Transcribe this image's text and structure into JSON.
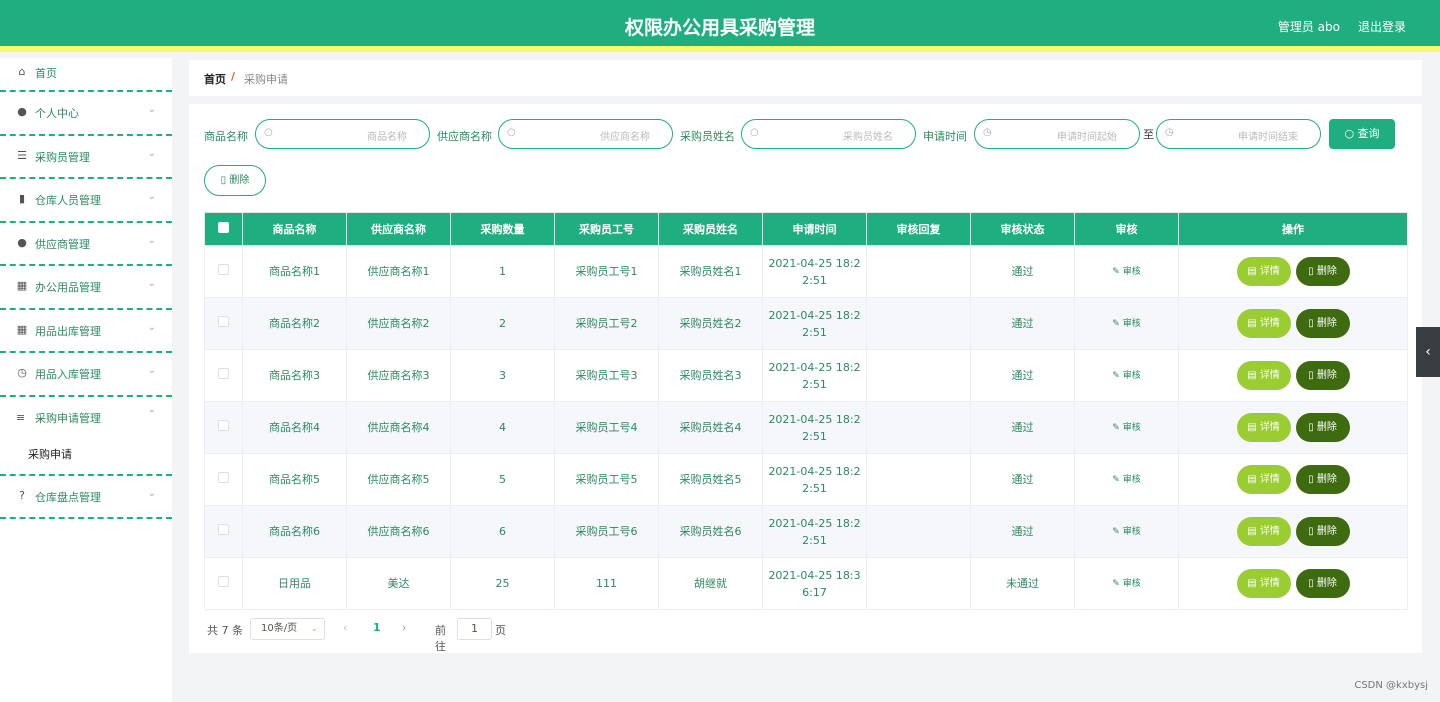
{
  "header": {
    "title": "权限办公用具采购管理",
    "user": "管理员 abo",
    "logout": "退出登录"
  },
  "sidebar": {
    "items": [
      {
        "label": "首页",
        "icon": "home-icon",
        "glyph": "⌂"
      },
      {
        "label": "个人中心",
        "icon": "user-icon",
        "glyph": "●"
      },
      {
        "label": "采购员管理",
        "icon": "list-icon",
        "glyph": "☰"
      },
      {
        "label": "仓库人员管理",
        "icon": "clipboard-icon",
        "glyph": "▮"
      },
      {
        "label": "供应商管理",
        "icon": "user-icon",
        "glyph": "●"
      },
      {
        "label": "办公用品管理",
        "icon": "grid-icon",
        "glyph": "▦"
      },
      {
        "label": "用品出库管理",
        "icon": "grid-icon",
        "glyph": "▦"
      },
      {
        "label": "用品入库管理",
        "icon": "compass-icon",
        "glyph": "◷"
      }
    ],
    "open_group": {
      "label": "采购申请管理",
      "icon": "menu-icon",
      "glyph": "≡",
      "sub": "采购申请"
    },
    "last": {
      "label": "仓库盘点管理",
      "icon": "help-icon",
      "glyph": "?"
    }
  },
  "breadcrumb": {
    "home": "首页",
    "sep": "/",
    "current": "采购申请"
  },
  "search": {
    "name_label": "商品名称",
    "name_ph": "商品名称",
    "supplier_label": "供应商名称",
    "supplier_ph": "供应商名称",
    "buyer_label": "采购员姓名",
    "buyer_ph": "采购员姓名",
    "time_label": "申请时间",
    "time_start_ph": "申请时间起始",
    "range_sep": "至",
    "time_end_ph": "申请时间结束",
    "query_btn": "查询",
    "delete_btn": "删除"
  },
  "table": {
    "headers": [
      "商品名称",
      "供应商名称",
      "采购数量",
      "采购员工号",
      "采购员姓名",
      "申请时间",
      "审核回复",
      "审核状态",
      "审核",
      "操作"
    ],
    "rows": [
      {
        "name": "商品名称1",
        "supplier": "供应商名称1",
        "qty": "1",
        "no": "采购员工号1",
        "buyer": "采购员姓名1",
        "time1": "2021-04-25 18:2",
        "time2": "2:51",
        "reply": "",
        "status": "通过",
        "review": "审核"
      },
      {
        "name": "商品名称2",
        "supplier": "供应商名称2",
        "qty": "2",
        "no": "采购员工号2",
        "buyer": "采购员姓名2",
        "time1": "2021-04-25 18:2",
        "time2": "2:51",
        "reply": "",
        "status": "通过",
        "review": "审核"
      },
      {
        "name": "商品名称3",
        "supplier": "供应商名称3",
        "qty": "3",
        "no": "采购员工号3",
        "buyer": "采购员姓名3",
        "time1": "2021-04-25 18:2",
        "time2": "2:51",
        "reply": "",
        "status": "通过",
        "review": "审核"
      },
      {
        "name": "商品名称4",
        "supplier": "供应商名称4",
        "qty": "4",
        "no": "采购员工号4",
        "buyer": "采购员姓名4",
        "time1": "2021-04-25 18:2",
        "time2": "2:51",
        "reply": "",
        "status": "通过",
        "review": "审核"
      },
      {
        "name": "商品名称5",
        "supplier": "供应商名称5",
        "qty": "5",
        "no": "采购员工号5",
        "buyer": "采购员姓名5",
        "time1": "2021-04-25 18:2",
        "time2": "2:51",
        "reply": "",
        "status": "通过",
        "review": "审核"
      },
      {
        "name": "商品名称6",
        "supplier": "供应商名称6",
        "qty": "6",
        "no": "采购员工号6",
        "buyer": "采购员姓名6",
        "time1": "2021-04-25 18:2",
        "time2": "2:51",
        "reply": "",
        "status": "通过",
        "review": "审核"
      },
      {
        "name": "日用品",
        "supplier": "美达",
        "qty": "25",
        "no": "111",
        "buyer": "胡继就",
        "time1": "2021-04-25 18:3",
        "time2": "6:17",
        "reply": "",
        "status": "未通过",
        "review": "审核"
      }
    ],
    "detail_btn": "详情",
    "delete_btn": "删除"
  },
  "pager": {
    "total": "共 7 条",
    "size": "10条/页",
    "prev": "‹",
    "page": "1",
    "next": "›",
    "goto": "前往",
    "goto_value": "1",
    "page_unit": "页"
  },
  "watermark": "CSDN @kxbysj",
  "colors": {
    "primary": "#1fae80",
    "accent_bar": "#f9f871",
    "detail_btn": "#9acd32",
    "delete_btn": "#3e6b10"
  }
}
